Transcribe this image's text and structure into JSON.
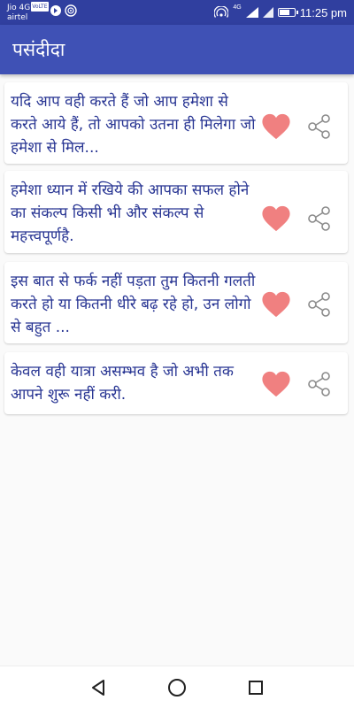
{
  "status_bar": {
    "carrier_top": "Jio 4G",
    "volte": "VoLTE",
    "carrier_bottom": "airtel",
    "network_type": "4G",
    "time": "11:25 pm",
    "battery_level": 0.75
  },
  "app_bar": {
    "title": "पसंदीदा"
  },
  "quotes": [
    {
      "text": "यदि आप वही करते हैं जो आप हमेशा से करते आये हैं, तो आपको उतना ही मिलेगा जो हमेशा से मिल..."
    },
    {
      "text": "हमेशा ध्यान में रखिये की आपका सफल होने का संकल्प किसी भी और संकल्प से महत्त्वपूर्णहै."
    },
    {
      "text": "इस बात से फर्क नहीं पड़ता तुम कितनी गलती करते हो या कितनी धीरे बढ़ रहे हो, उन लोगो से बहुत ..."
    },
    {
      "text": "केवल वही यात्रा असम्भव है जो अभी तक आपने शुरू नहीं करी."
    }
  ],
  "icons": {
    "favorite": "heart-icon",
    "share": "share-icon",
    "back": "back-triangle-icon",
    "home": "home-circle-icon",
    "recents": "recents-square-icon"
  },
  "colors": {
    "status_bar": "#303f9f",
    "app_bar": "#3f51b5",
    "quote_text": "#283593",
    "heart": "#f08080",
    "share": "#8a8a8a"
  }
}
